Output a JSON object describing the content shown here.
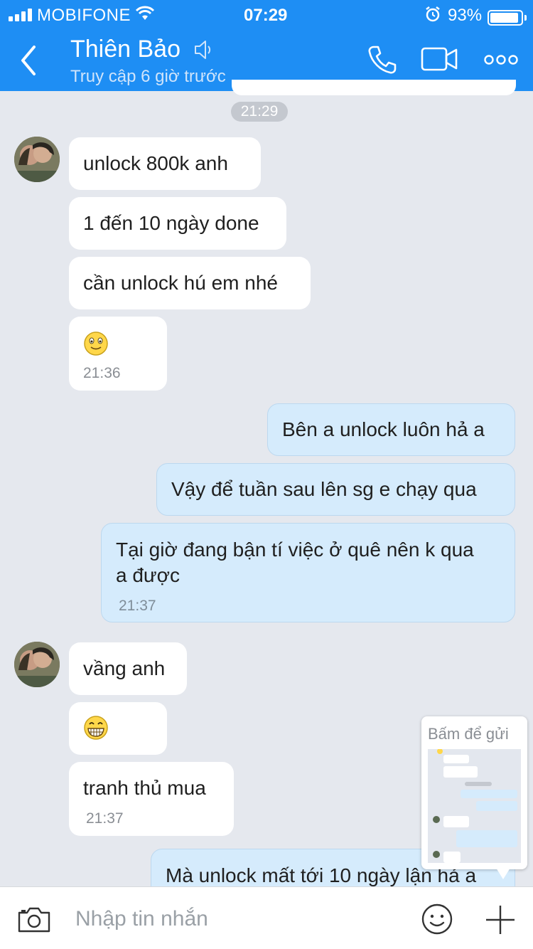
{
  "status_bar": {
    "carrier": "MOBIFONE",
    "time": "07:29",
    "battery": "93%"
  },
  "header": {
    "name": "Thiên Bảo",
    "status": "Truy cập 6 giờ trước"
  },
  "messages": {
    "time_divider": "21:29",
    "m1": "unlock 800k anh",
    "m2": "1 đến 10 ngày done",
    "m3": "cần unlock hú em nhé",
    "m4_time": "21:36",
    "m5": "Bên a unlock luôn hả a",
    "m6": "Vậy để tuần sau lên sg e chạy qua",
    "m7_line1": "Tại giờ đang bận tí việc ở quê nên k qua",
    "m7_line2": "a được",
    "m7_time": "21:37",
    "m8": "vầng anh",
    "m10": "tranh thủ mua",
    "m10_time": "21:37",
    "m11": "Mà unlock mất tới 10 ngày lận hả a"
  },
  "preview": {
    "label": "Bấm để gửi"
  },
  "input": {
    "placeholder": "Nhập tin nhắn"
  }
}
